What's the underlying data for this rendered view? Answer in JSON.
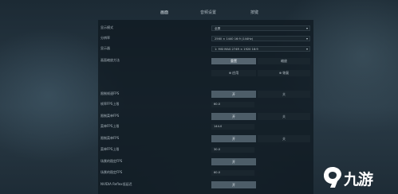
{
  "tabs": [
    "画面",
    "音频设置",
    "按键"
  ],
  "top_markers": [
    "",
    "",
    "",
    "",
    "",
    ""
  ],
  "settings": {
    "display_mode": {
      "label": "显示模式",
      "value": "全屏"
    },
    "resolution": {
      "label": "分辨率",
      "value": "2560 × 1440 16:9 (144Hz)"
    },
    "monitor": {
      "label": "显示器",
      "value": "1: MSI MAG 274R × 1920 16:9"
    },
    "scale_label": "画面缩放方法",
    "scale_buttons": [
      "重置",
      "缩放"
    ],
    "apply_buttons": [
      "⊕ 应用",
      "⊕ 恢复"
    ],
    "rows": [
      {
        "label": "限制帧速FPS",
        "kind": "toggle",
        "on": "开",
        "off": "关"
      },
      {
        "label": "帧率FPS上限",
        "kind": "value",
        "value": "60.0"
      },
      {
        "label": "限制菜单FPS",
        "kind": "toggle",
        "on": "开",
        "off": "关"
      },
      {
        "label": "菜单FPS上限",
        "kind": "value",
        "value": "144.0"
      },
      {
        "label": "限制菜单FPS",
        "kind": "toggle",
        "on": "开",
        "off": "关"
      },
      {
        "label": "菜单FPS上限",
        "kind": "value",
        "value": "30.0"
      },
      {
        "label": "场景的稳定FPS",
        "kind": "toggle_single",
        "on": "开"
      },
      {
        "label": "场景的稳定FPS",
        "kind": "value",
        "value": "60.0"
      },
      {
        "label": "NVIDIA Reflex低延迟",
        "kind": "toggle_single",
        "on": "开"
      }
    ]
  },
  "watermark": {
    "text": "九游"
  },
  "colors": {
    "accent": "#55646f",
    "panel": "#101a21",
    "watermark": "#ffffff"
  }
}
